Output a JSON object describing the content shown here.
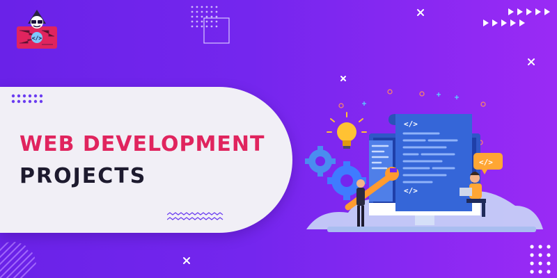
{
  "banner": {
    "title_line1": "WEB DEVELOPMENT",
    "title_line2": "PROJECTS",
    "code_tag_main": "</>",
    "code_tag_bubble": "</>",
    "logo_tag": "</>"
  },
  "colors": {
    "background_start": "#6a22e8",
    "background_end": "#9a2af5",
    "title_accent": "#e0245e",
    "title_dark": "#1d1a2e",
    "pill": "#f1eff6"
  },
  "icons": [
    "logo-icon",
    "lightbulb-icon",
    "gear-icon",
    "wrench-icon",
    "monitor-icon",
    "developer-person-icon",
    "laptop-icon",
    "code-bubble-icon"
  ]
}
